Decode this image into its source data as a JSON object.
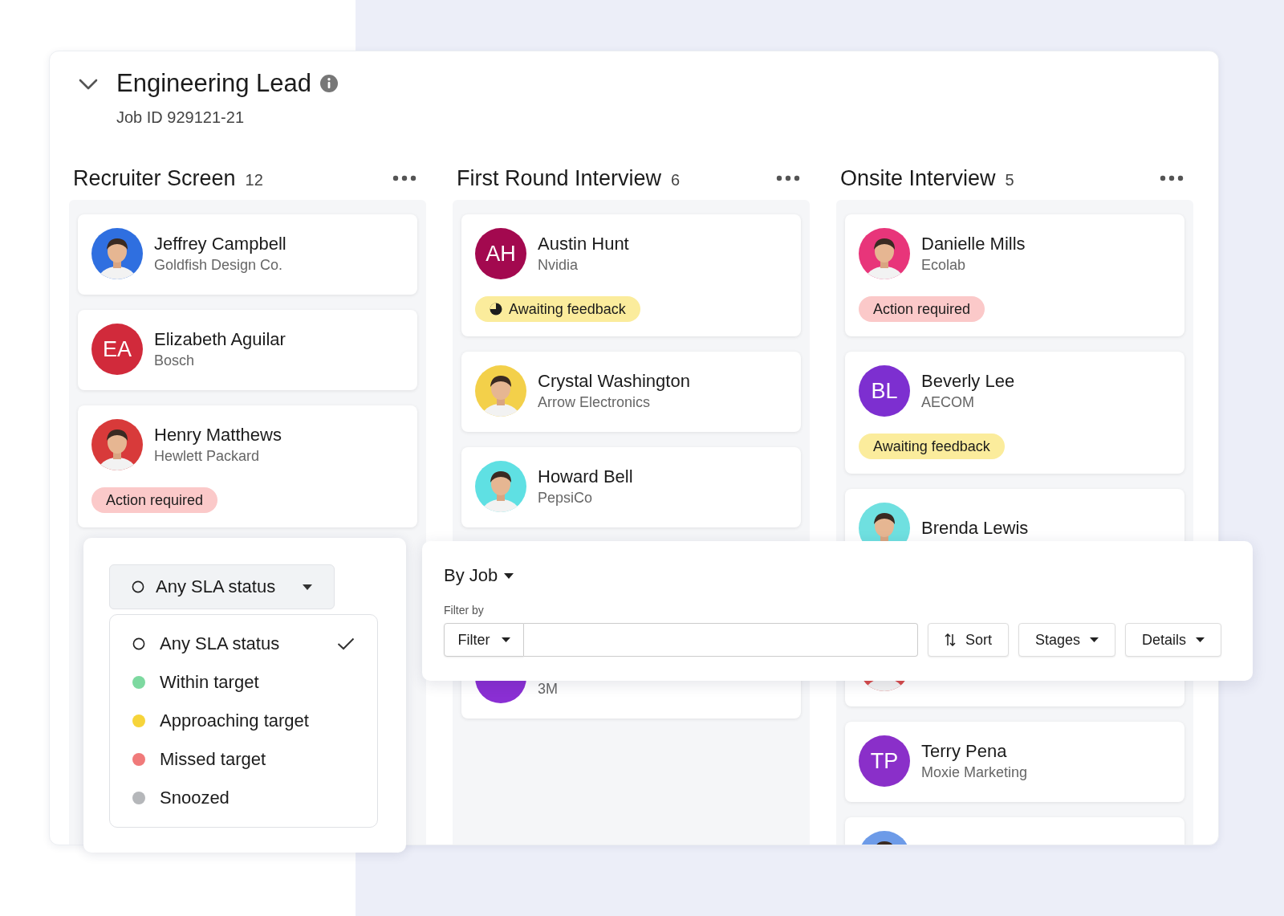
{
  "job": {
    "title": "Engineering Lead",
    "job_id": "Job ID 929121-21",
    "expanded": true
  },
  "columns": [
    {
      "title": "Recruiter Screen",
      "count": "12",
      "cards": [
        {
          "kind": "short",
          "name": "Jeffrey Campbell",
          "company": "Goldfish Design Co.",
          "avatar": {
            "kind": "photo",
            "color": "#2f6fe0"
          }
        },
        {
          "kind": "short",
          "name": "Elizabeth Aguilar",
          "company": "Bosch",
          "avatar": {
            "kind": "initials",
            "initials": "EA",
            "color": "#d12a3b"
          }
        },
        {
          "kind": "tall",
          "name": "Henry Matthews",
          "company": "Hewlett Packard",
          "avatar": {
            "kind": "photo",
            "color": "#d83a3a"
          },
          "badge": {
            "kind": "action",
            "label": "Action required",
            "pie_icon": false
          }
        }
      ]
    },
    {
      "title": "First Round Interview",
      "count": "6",
      "cards": [
        {
          "kind": "tall",
          "name": "Austin Hunt",
          "company": "Nvidia",
          "avatar": {
            "kind": "initials",
            "initials": "AH",
            "color": "#a3094f"
          },
          "badge": {
            "kind": "awaiting",
            "label": "Awaiting feedback",
            "pie_icon": true
          }
        },
        {
          "kind": "short",
          "name": "Crystal Washington",
          "company": "Arrow Electronics",
          "avatar": {
            "kind": "photo",
            "color": "#f3d04a"
          }
        },
        {
          "kind": "short",
          "name": "Howard Bell",
          "company": "PepsiCo",
          "avatar": {
            "kind": "photo",
            "color": "#5fe0e3"
          }
        },
        {
          "kind": "blank"
        },
        {
          "kind": "short",
          "company": "3M",
          "avatar": {
            "kind": "initials",
            "color": "#8a2fd3"
          }
        }
      ]
    },
    {
      "title": "Onsite Interview",
      "count": "5",
      "cards": [
        {
          "kind": "tall",
          "name": "Danielle Mills",
          "company": "Ecolab",
          "avatar": {
            "kind": "photo",
            "color": "#e8357a"
          },
          "badge": {
            "kind": "action",
            "label": "Action required",
            "pie_icon": false
          }
        },
        {
          "kind": "tall",
          "name": "Beverly Lee",
          "company": "AECOM",
          "avatar": {
            "kind": "initials",
            "initials": "BL",
            "color": "#7d2fd0"
          },
          "badge": {
            "kind": "awaiting",
            "label": "Awaiting feedback",
            "pie_icon": false
          }
        },
        {
          "kind": "tall",
          "name": "Brenda Lewis",
          "avatar": {
            "kind": "photo",
            "color": "#6fe0e0"
          }
        },
        {
          "kind": "short",
          "avatar": {
            "kind": "photo",
            "color": "#d84a4a"
          }
        },
        {
          "kind": "short",
          "name": "Terry Pena",
          "company": "Moxie Marketing",
          "avatar": {
            "kind": "initials",
            "initials": "TP",
            "color": "#8a2fc9"
          }
        },
        {
          "kind": "short",
          "avatar": {
            "kind": "photo",
            "color": "#6d9be8"
          }
        }
      ]
    }
  ],
  "sla": {
    "select": {
      "label": "Any SLA status"
    },
    "options": [
      {
        "label": "Any SLA status",
        "kind": "ring",
        "selected": true
      },
      {
        "label": "Within target",
        "kind": "dot",
        "color": "#7dd9a0",
        "selected": false
      },
      {
        "label": "Approaching target",
        "kind": "dot",
        "color": "#f6d43a",
        "selected": false
      },
      {
        "label": "Missed target",
        "kind": "dot",
        "color": "#f07a7a",
        "selected": false
      },
      {
        "label": "Snoozed",
        "kind": "dot",
        "color": "#b5b7ba",
        "selected": false
      }
    ]
  },
  "filter_bar": {
    "view": "By Job",
    "filter_label": "Filter by",
    "filter_button": "Filter",
    "buttons": [
      {
        "label": "Sort",
        "kind": "sort"
      },
      {
        "label": "Stages",
        "kind": "dropdown"
      },
      {
        "label": "Details",
        "kind": "dropdown"
      }
    ]
  }
}
